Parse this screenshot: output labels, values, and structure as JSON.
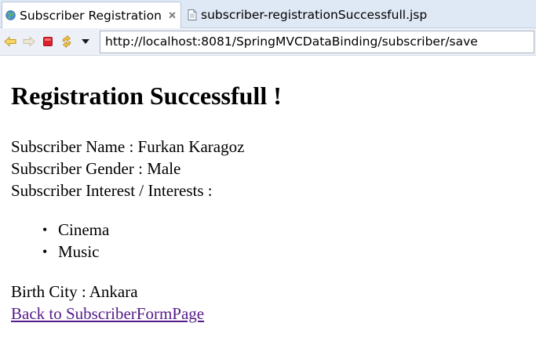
{
  "tabs": [
    {
      "label": "Subscriber Registration",
      "icon": "globe-icon",
      "active": true
    },
    {
      "label": "subscriber-registrationSuccessfull.jsp",
      "icon": "page-icon",
      "active": false
    }
  ],
  "toolbar": {
    "url": "http://localhost:8081/SpringMVCDataBinding/subscriber/save",
    "buttons": [
      "back-icon",
      "forward-icon",
      "stop-icon",
      "refresh-icon",
      "menu-dropdown-icon"
    ]
  },
  "page": {
    "heading": "Registration Successfull !",
    "name_line": "Subscriber Name : Furkan Karagoz",
    "gender_line": "Subscriber Gender : Male",
    "interests_line": "Subscriber Interest / Interests :",
    "interests": [
      "Cinema",
      "Music"
    ],
    "city_line": "Birth City : Ankara",
    "back_link": "Back to SubscriberFormPage"
  },
  "colors": {
    "tabstrip_bg": "#dfe8f5",
    "toolbar_bg": "#edf1f7",
    "visited_link": "#551a8b",
    "stop_red": "#d9202c"
  }
}
